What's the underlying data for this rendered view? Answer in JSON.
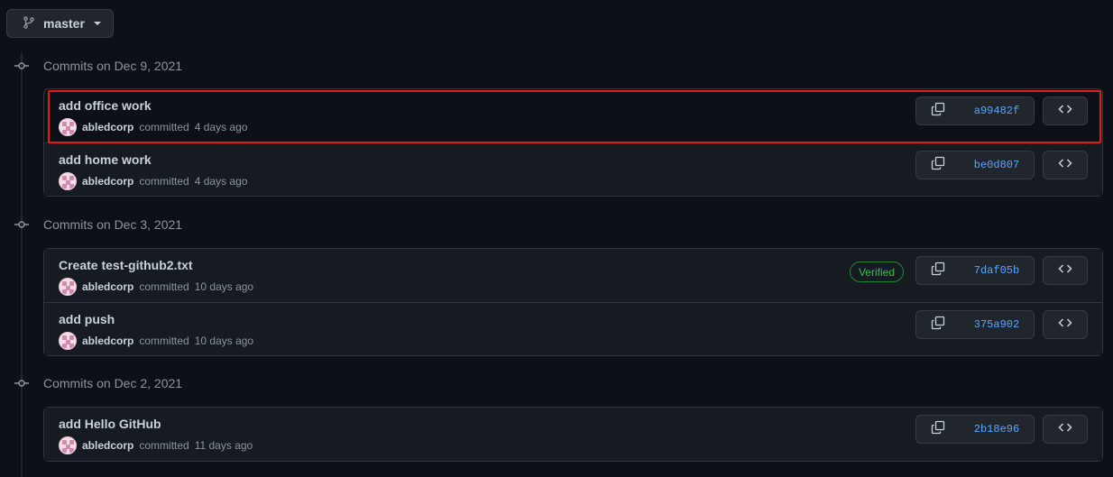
{
  "branch": {
    "name": "master"
  },
  "groups": [
    {
      "heading": "Commits on Dec 9, 2021",
      "commits": [
        {
          "title": "add office work",
          "author": "abledcorp",
          "action": "committed",
          "time": "4 days ago",
          "sha": "a99482f",
          "verified": ""
        },
        {
          "title": "add home work",
          "author": "abledcorp",
          "action": "committed",
          "time": "4 days ago",
          "sha": "be0d807",
          "verified": ""
        }
      ]
    },
    {
      "heading": "Commits on Dec 3, 2021",
      "commits": [
        {
          "title": "Create test-github2.txt",
          "author": "abledcorp",
          "action": "committed",
          "time": "10 days ago",
          "sha": "7daf05b",
          "verified": "Verified"
        },
        {
          "title": "add push",
          "author": "abledcorp",
          "action": "committed",
          "time": "10 days ago",
          "sha": "375a902",
          "verified": ""
        }
      ]
    },
    {
      "heading": "Commits on Dec 2, 2021",
      "commits": [
        {
          "title": "add Hello GitHub",
          "author": "abledcorp",
          "action": "committed",
          "time": "11 days ago",
          "sha": "2b18e96",
          "verified": ""
        }
      ]
    }
  ],
  "icons": {
    "branch": "git-branch-icon",
    "commit": "git-commit-icon",
    "copy": "copy-icon",
    "code": "code-icon"
  },
  "colors": {
    "background": "#0d1117",
    "link": "#58a6ff",
    "verified": "#3fb950",
    "highlight": "#e01b1b"
  }
}
